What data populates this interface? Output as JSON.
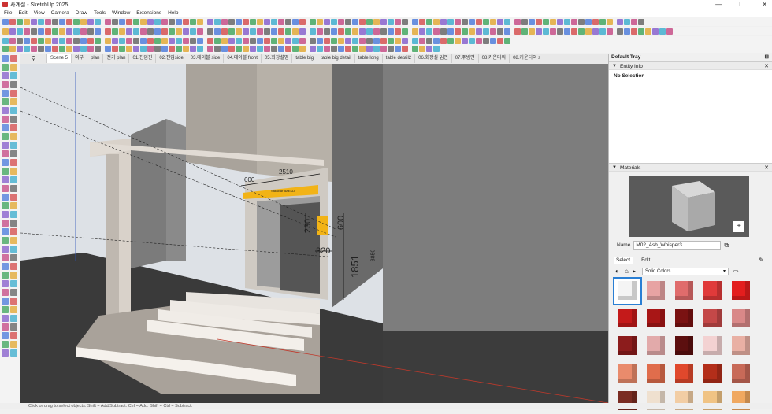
{
  "window": {
    "title": "사계절 - SketchUp 2025",
    "controls": [
      "—",
      "☐",
      "✕"
    ]
  },
  "menu": [
    "File",
    "Edit",
    "View",
    "Camera",
    "Draw",
    "Tools",
    "Window",
    "Extensions",
    "Help"
  ],
  "scene_tabs": [
    "Scene 5",
    "외부",
    "plan",
    "전기 plan",
    "01.진입진",
    "02.진입side",
    "03.테이블 side",
    "04.테이블 front",
    "05.회장설명",
    "table big",
    "table big detail",
    "table long",
    "table detail2",
    "06.회장실 입면",
    "07.주방면",
    "08.커운터외",
    "08.커운터외 s"
  ],
  "search_icon_label": "⚲",
  "viewport": {
    "dimensions": [
      "600",
      "2510",
      "230",
      "600",
      "320",
      "1851",
      "3850"
    ],
    "sign_text": "SakuBar BAEKD"
  },
  "tray": {
    "title": "Default Tray",
    "entity_info": {
      "header": "Entity Info",
      "selection": "No Selection"
    },
    "materials": {
      "header": "Materials",
      "name_label": "Name",
      "name_value": "M02_Ash_Whisper3",
      "tabs": [
        "Select",
        "Edit"
      ],
      "collection": "Solid Colors",
      "swatch_colors": [
        "#f4f4f4",
        "#e7a3a3",
        "#e06c6c",
        "#e03a3a",
        "#e31e1e",
        "#c41a1a",
        "#a81616",
        "#7a1212",
        "#c44848",
        "#d98888",
        "#8c1c1c",
        "#e2aaaa",
        "#5c0f0f",
        "#f3d2d2",
        "#e9b0a4",
        "#e98b6c",
        "#e06d4c",
        "#e0482c",
        "#b32e1a",
        "#c86a58",
        "#7a2c22",
        "#efe0cf",
        "#f2cda4",
        "#f0c384",
        "#f0a860"
      ]
    }
  },
  "status": "Click or drag to select objects. Shift = Add/Subtract. Ctrl = Add. Shift + Ctrl = Subtract."
}
